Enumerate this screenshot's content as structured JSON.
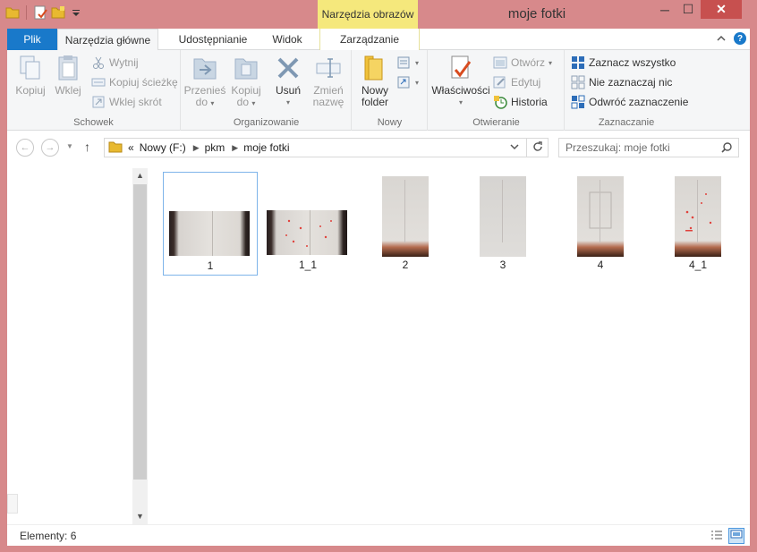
{
  "titlebar": {
    "context_tab": "Narzędzia obrazów",
    "title": "moje fotki"
  },
  "window_buttons": {
    "minimize": "─",
    "maximize": "☐",
    "close": "✕"
  },
  "tabs": {
    "file": "Plik",
    "home": "Narzędzia główne",
    "share": "Udostępnianie",
    "view": "Widok",
    "manage": "Zarządzanie"
  },
  "ribbon": {
    "clipboard": {
      "label": "Schowek",
      "copy": "Kopiuj",
      "paste": "Wklej",
      "cut": "Wytnij",
      "copy_path": "Kopiuj ścieżkę",
      "paste_shortcut": "Wklej skrót"
    },
    "organize": {
      "label": "Organizowanie",
      "move_to_1": "Przenieś",
      "move_to_2": "do",
      "copy_to_1": "Kopiuj",
      "copy_to_2": "do",
      "delete": "Usuń",
      "rename_1": "Zmień",
      "rename_2": "nazwę"
    },
    "new": {
      "label": "Nowy",
      "new_folder_1": "Nowy",
      "new_folder_2": "folder"
    },
    "open": {
      "label": "Otwieranie",
      "properties": "Właściwości",
      "open": "Otwórz",
      "edit": "Edytuj",
      "history": "Historia"
    },
    "select": {
      "label": "Zaznaczanie",
      "select_all": "Zaznacz wszystko",
      "select_none": "Nie zaznaczaj nic",
      "invert": "Odwróć zaznaczenie"
    }
  },
  "address": {
    "prefix": "«",
    "crumbs": [
      "Nowy (F:)",
      "pkm",
      "moje fotki"
    ],
    "search_placeholder": "Przeszukaj: moje fotki"
  },
  "files": [
    {
      "name": "1",
      "orientation": "landscape",
      "selected": true
    },
    {
      "name": "1_1",
      "orientation": "landscape",
      "selected": false
    },
    {
      "name": "2",
      "orientation": "portrait",
      "selected": false
    },
    {
      "name": "3",
      "orientation": "portrait",
      "selected": false
    },
    {
      "name": "4",
      "orientation": "portrait",
      "selected": false
    },
    {
      "name": "4_1",
      "orientation": "portrait",
      "selected": false
    }
  ],
  "status": {
    "count": "Elementy: 6"
  }
}
